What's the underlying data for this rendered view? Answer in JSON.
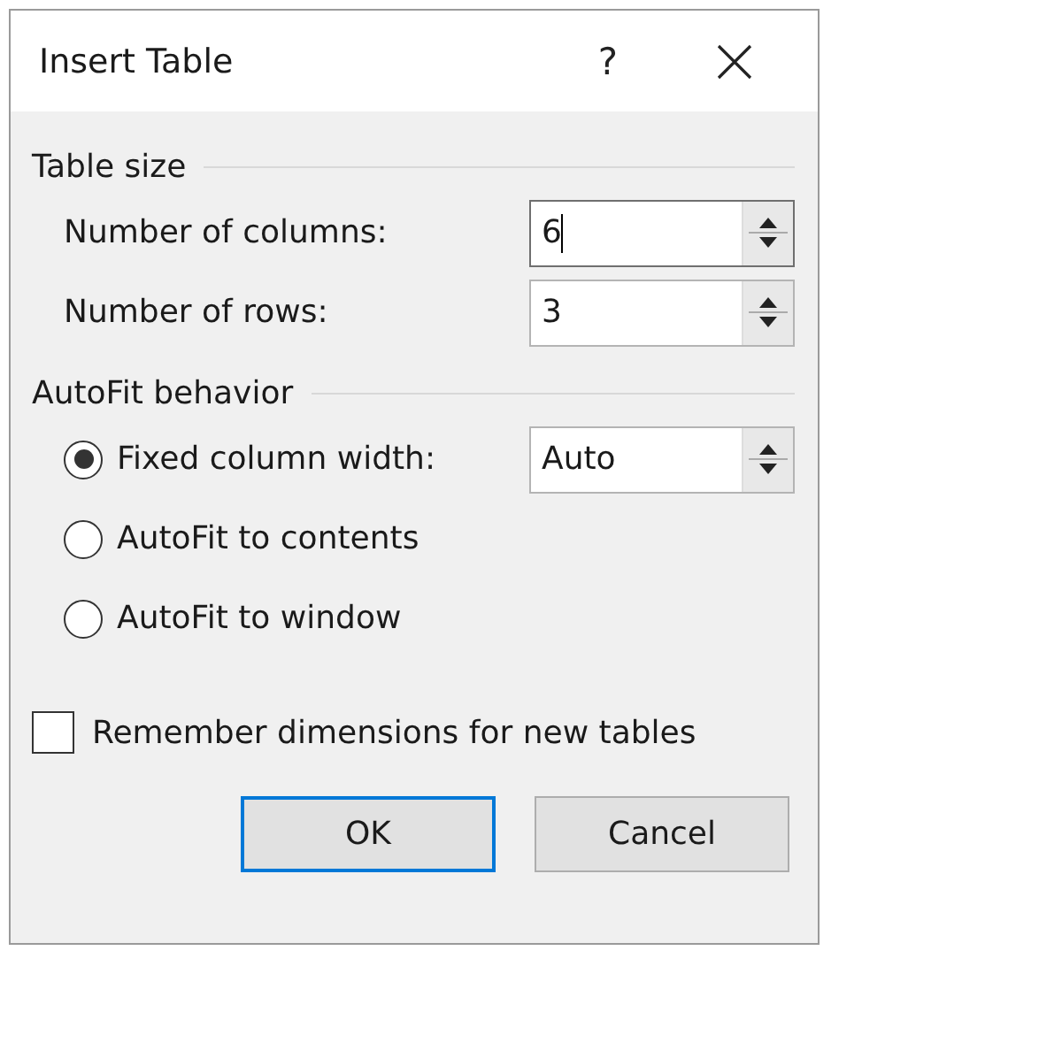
{
  "window": {
    "title": "Insert Table",
    "help": "?"
  },
  "table_size": {
    "heading": "Table size",
    "fields": [
      {
        "label": "Number of columns:",
        "value": "6",
        "focused": true
      },
      {
        "label": "Number of rows:",
        "value": "3",
        "focused": false
      }
    ]
  },
  "autofit": {
    "heading": "AutoFit behavior",
    "options": [
      {
        "label": "Fixed column width:",
        "selected": true,
        "value": "Auto"
      },
      {
        "label": "AutoFit to contents",
        "selected": false
      },
      {
        "label": "AutoFit to window",
        "selected": false
      }
    ]
  },
  "remember": {
    "label": "Remember dimensions for new tables",
    "checked": false
  },
  "buttons": [
    {
      "label": "OK",
      "default": true
    },
    {
      "label": "Cancel",
      "default": false
    }
  ]
}
